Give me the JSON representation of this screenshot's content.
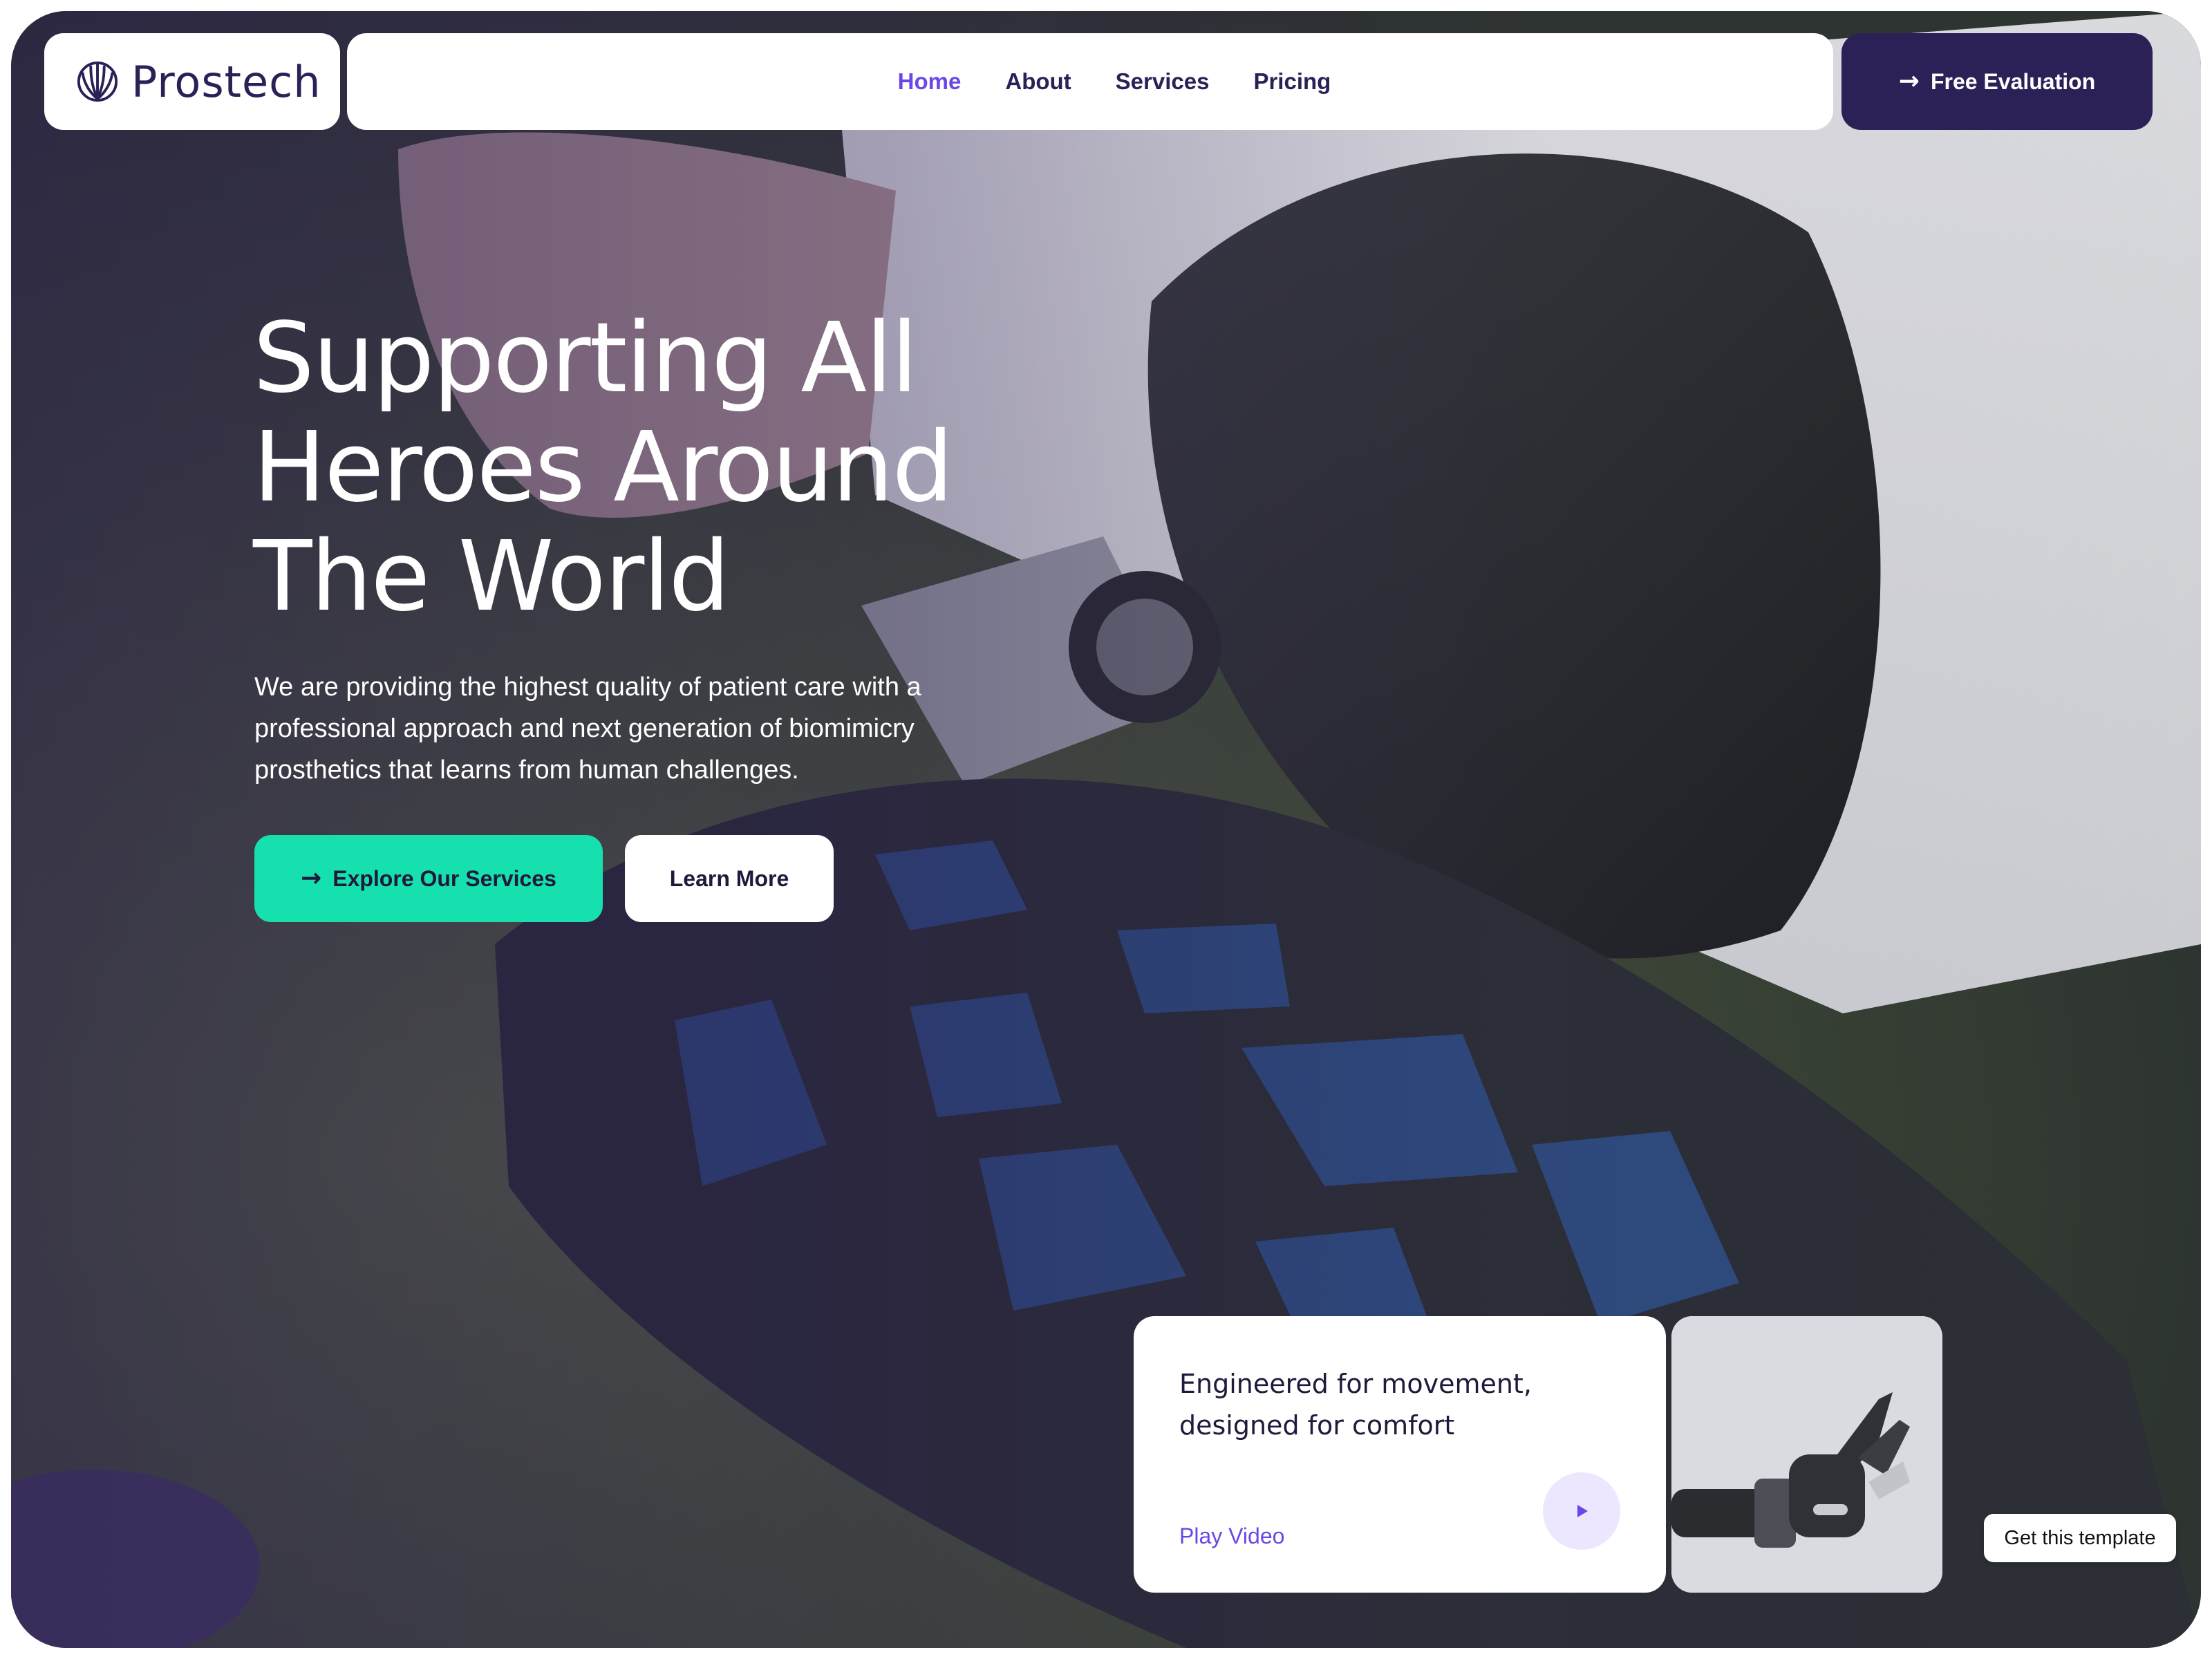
{
  "brand": {
    "name": "Prostech",
    "icon": "shell-logo-icon"
  },
  "nav": {
    "items": [
      {
        "label": "Home",
        "active": true
      },
      {
        "label": "About",
        "active": false
      },
      {
        "label": "Services",
        "active": false
      },
      {
        "label": "Pricing",
        "active": false
      }
    ],
    "cta_label": "Free Evaluation",
    "cta_icon": "arrow-right-icon"
  },
  "hero": {
    "title_lines": [
      "Supporting All",
      "Heroes Around",
      "The World"
    ],
    "description_lines": [
      "We are providing the highest quality of patient care with a",
      "professional approach and next generation of biomimicry",
      "prosthetics that learns from human challenges."
    ],
    "primary_button": "Explore Our Services",
    "primary_icon": "arrow-right-icon",
    "secondary_button": "Learn More"
  },
  "video_card": {
    "title_lines": [
      "Engineered for movement,",
      "designed for comfort"
    ],
    "link_label": "Play Video",
    "play_icon": "play-icon"
  },
  "badge": {
    "label": "Get this template"
  },
  "colors": {
    "brand_dark": "#2b2157",
    "accent_purple": "#6a47e6",
    "accent_green": "#16e0ad",
    "play_bg": "#ece6ff"
  }
}
